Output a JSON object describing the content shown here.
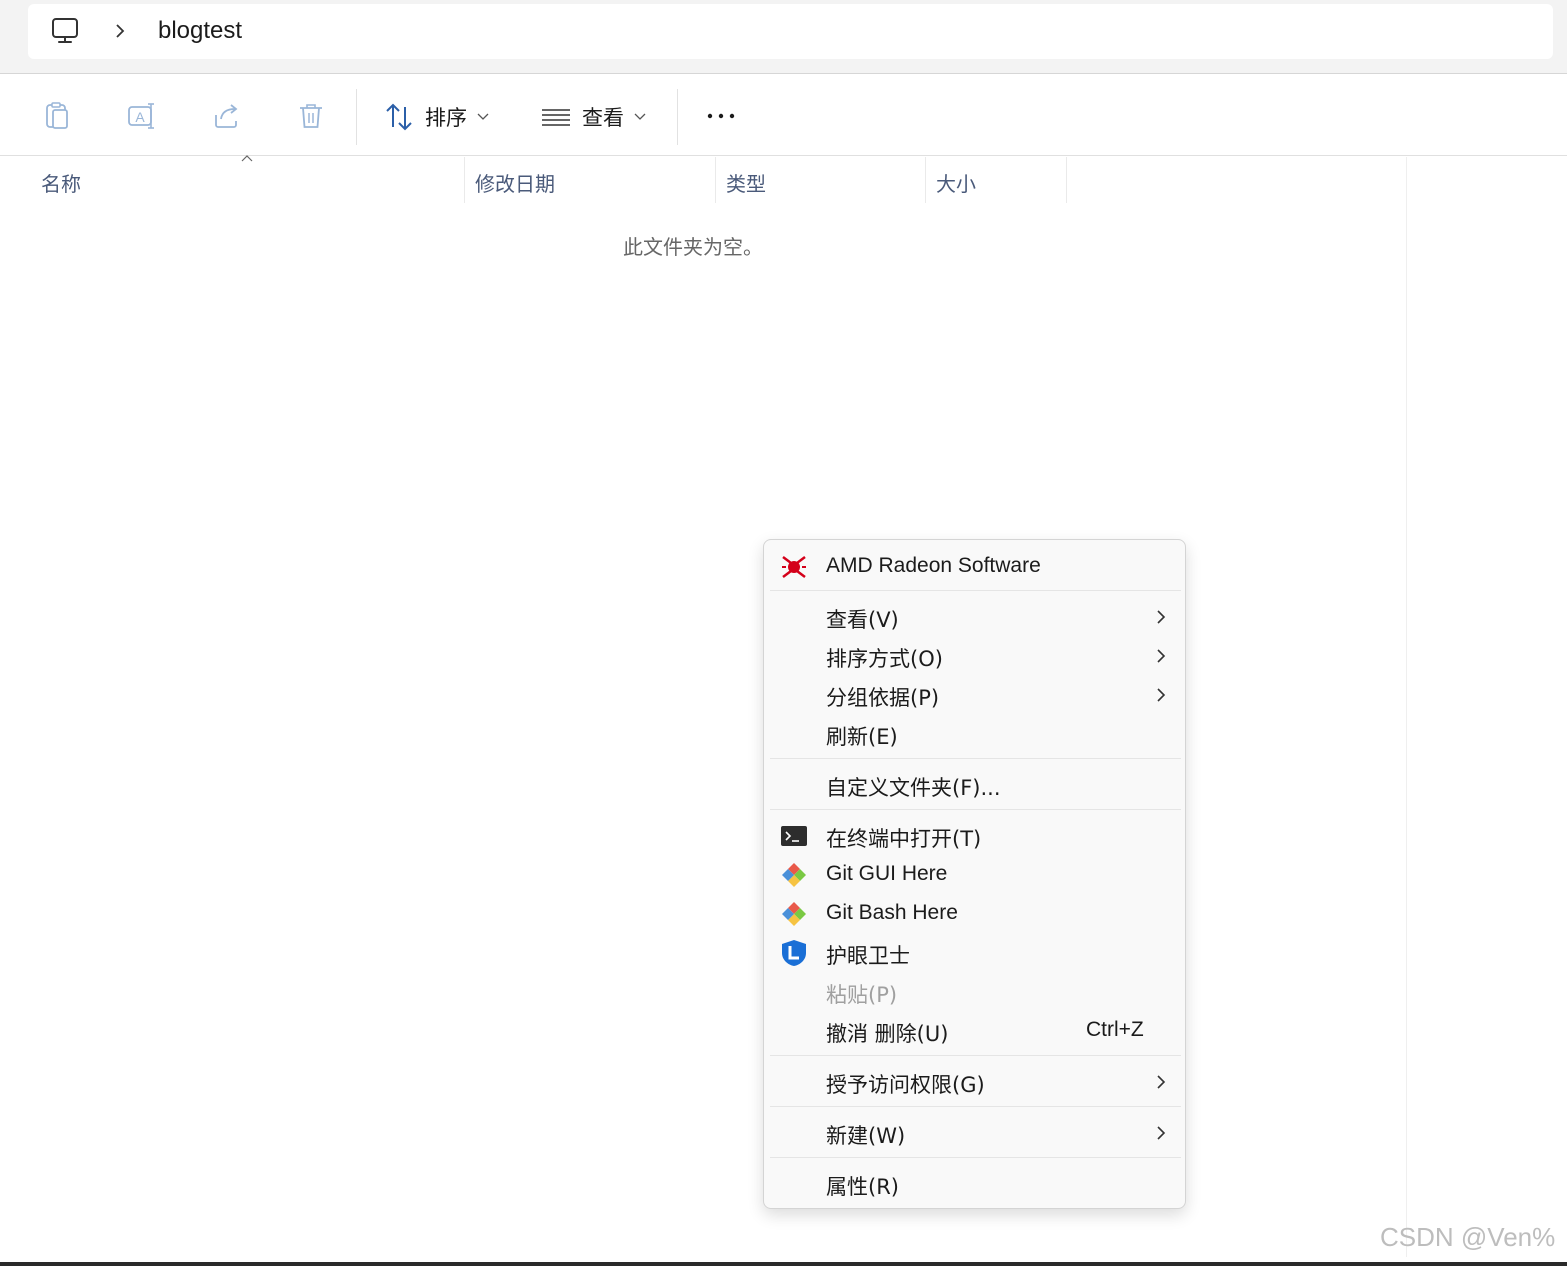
{
  "address_bar": {
    "folder": "blogtest"
  },
  "toolbar": {
    "sort_label": "排序",
    "view_label": "查看"
  },
  "columns": {
    "name": "名称",
    "modified": "修改日期",
    "type": "类型",
    "size": "大小"
  },
  "empty_message": "此文件夹为空。",
  "context_menu": {
    "amd": "AMD Radeon Software",
    "view": "查看(V)",
    "sort_by": "排序方式(O)",
    "group_by": "分组依据(P)",
    "refresh": "刷新(E)",
    "customize": "自定义文件夹(F)...",
    "open_terminal": "在终端中打开(T)",
    "git_gui": "Git GUI Here",
    "git_bash": "Git Bash Here",
    "eye_guard": "护眼卫士",
    "paste": "粘贴(P)",
    "undo_delete": "撤消 删除(U)",
    "undo_shortcut": "Ctrl+Z",
    "grant_access": "授予访问权限(G)",
    "new": "新建(W)",
    "properties": "属性(R)"
  },
  "watermark": "CSDN @Ven%",
  "icons": {
    "pc": "computer-icon",
    "copy": "copy-icon",
    "rename": "rename-icon",
    "share": "share-icon",
    "delete": "trash-icon",
    "sort": "sort-arrows-icon",
    "view": "list-view-icon",
    "more": "more-dots-icon",
    "amd": "amd-radeon-icon",
    "terminal": "terminal-icon",
    "git": "git-icon",
    "eye_guard": "shield-icon"
  },
  "colors": {
    "accent_blue": "#0067c0",
    "amd_red": "#d4001a",
    "disabled_text": "#a0a0a0"
  }
}
